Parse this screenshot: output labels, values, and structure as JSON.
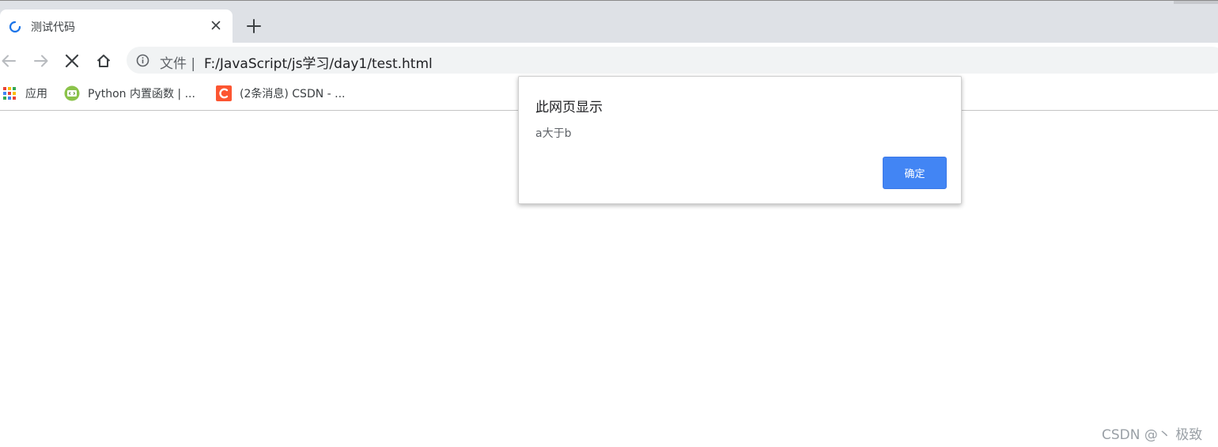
{
  "tab": {
    "title": "测试代码",
    "icon": "loading-spinner-icon",
    "close_icon": "close-icon"
  },
  "toolbar": {
    "back_icon": "back-arrow-icon",
    "forward_icon": "forward-arrow-icon",
    "stop_icon": "stop-loading-icon",
    "home_icon": "home-icon",
    "new_tab_icon": "plus-icon"
  },
  "omnibox": {
    "info_icon": "info-icon",
    "scheme_label": "文件 |",
    "url": "F:/JavaScript/js学习/day1/test.html"
  },
  "bookmarks": [
    {
      "label": "应用",
      "icon": "apps-grid-icon"
    },
    {
      "label": "Python 内置函数 | ...",
      "icon": "python-favicon-icon"
    },
    {
      "label": "(2条消息) CSDN - ...",
      "icon": "csdn-favicon-icon"
    }
  ],
  "dialog": {
    "title": "此网页显示",
    "message": "a大于b",
    "ok_label": "确定"
  },
  "watermark": "CSDN @丶 极致",
  "colors": {
    "tabstrip": "#dee1e6",
    "omnibox": "#f1f3f4",
    "accent": "#4285f4",
    "csdn": "#fc5531",
    "python": "#8bc34a"
  }
}
